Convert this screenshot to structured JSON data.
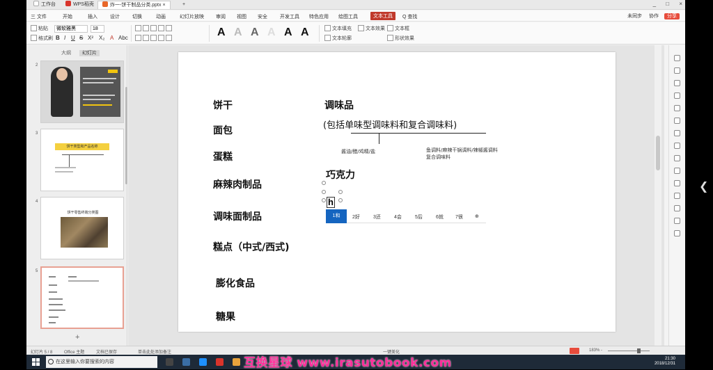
{
  "titlebar": {
    "tabs": [
      {
        "label": "工作台",
        "color": "#ffffff"
      },
      {
        "label": "WPS稻壳",
        "color": "#d9342b"
      },
      {
        "label": "炸一-饼干制品分类.pptx",
        "color": "#e8672a"
      }
    ],
    "new_tab": "+",
    "win_controls": [
      "_",
      "□",
      "×"
    ]
  },
  "menubar": {
    "items": [
      "三 文件",
      "开始",
      "插入",
      "设计",
      "切换",
      "动画",
      "幻灯片放映",
      "审阅",
      "视图",
      "安全",
      "开发工具",
      "特色应用",
      "绘图工具",
      "文本工具",
      "Q 查找"
    ],
    "active_index": 13,
    "right": {
      "sync": "未同步",
      "collab": "协作",
      "share": "分享"
    }
  },
  "ribbon": {
    "font_name": "微软雅黑",
    "font_size": "18",
    "buttons": [
      "粘贴",
      "格式刷",
      "B",
      "I",
      "U",
      "S",
      "X²",
      "X₂",
      "A",
      "Abc"
    ],
    "wordart": [
      "A",
      "A",
      "A",
      "A",
      "A",
      "A"
    ],
    "right_buttons": [
      "文本填充",
      "文本轮廓",
      "文本效果",
      "文本框",
      "形状效果"
    ]
  },
  "leftpanel": {
    "tabs": [
      "大纲",
      "幻灯片"
    ],
    "slide_numbers": [
      "2",
      "3",
      "4",
      "5"
    ],
    "thumb3_title": "饼干类型和产品名称",
    "thumb4_title": "饼干零售终端分类图"
  },
  "slide": {
    "left_items": [
      "饼干",
      "面包",
      "蛋糕",
      "麻辣肉制品",
      "调味面制品",
      "糕点（中式/西式)",
      "膨化食品",
      "糖果"
    ],
    "heading": "调味品",
    "subheading": "(包括单味型调味料和复合调味料)",
    "branch_left": "酱油/醋/鸡精/盐",
    "branch_right_1": "鱼调料/麻辣干锅调料/辣椒酱调料",
    "branch_right_2": "复合调味料",
    "chocolate": "巧克力",
    "typed_char": "h"
  },
  "ime": {
    "candidates": [
      "1和",
      "2好",
      "3还",
      "4会",
      "5后",
      "6就",
      "7很"
    ]
  },
  "statusbar": {
    "slide_info": "幻灯片 5 / 8",
    "theme": "Office 主题",
    "autosave": "文档已保存",
    "notes": "单击此处添加备注",
    "beautify": "一键美化",
    "zoom": "183% -"
  },
  "taskbar": {
    "search_placeholder": "在这里输入你要搜索的内容",
    "time": "21:30",
    "date": "2018/12/31"
  },
  "watermark": "互换星球 www.irasutobook.com",
  "colors": {
    "accent": "#c0392b",
    "ime_selected": "#1565c0",
    "watermark": "#ff2e9a"
  }
}
